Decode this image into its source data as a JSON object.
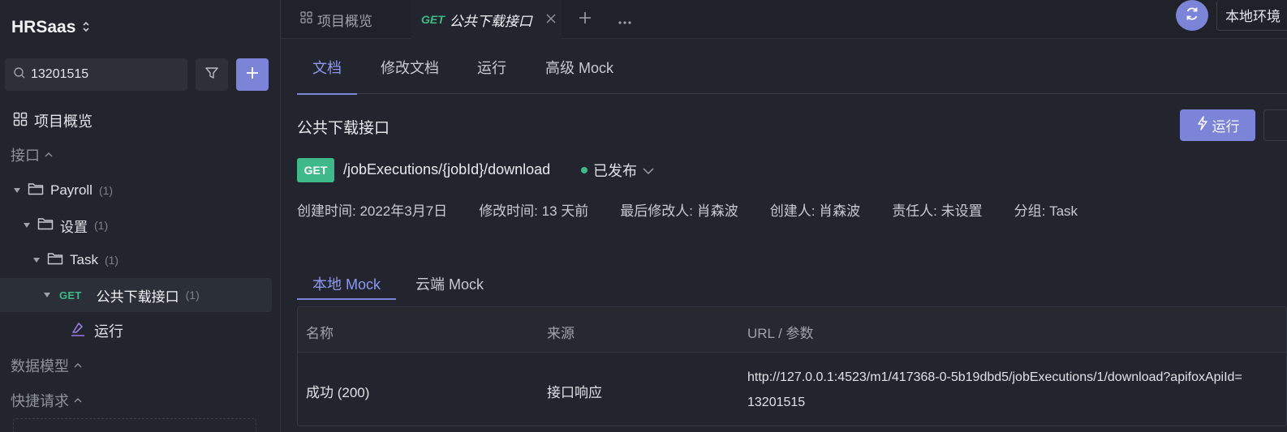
{
  "sidebar": {
    "project_name": "HRSaas",
    "search_value": "13201515",
    "overview_label": "项目概览",
    "sections": {
      "interfaces": "接口",
      "data_models": "数据模型",
      "quick_requests": "快捷请求"
    },
    "tree": [
      {
        "label": "Payroll",
        "count": "(1)"
      },
      {
        "label": "设置",
        "count": "(1)"
      },
      {
        "label": "Task",
        "count": "(1)"
      },
      {
        "method": "GET",
        "label": "公共下载接口",
        "count": "(1)"
      }
    ],
    "run_label": "运行"
  },
  "tabbar": {
    "overview_tab": "项目概览",
    "active_tab_method": "GET",
    "active_tab_title": "公共下载接口",
    "env_label": "本地环境"
  },
  "main": {
    "sub_tabs": [
      "文档",
      "修改文档",
      "运行",
      "高级 Mock"
    ],
    "api_name": "公共下载接口",
    "run_button": "运行",
    "method": "GET",
    "path": "/jobExecutions/{jobId}/download",
    "status": "已发布",
    "meta": [
      "创建时间: 2022年3月7日",
      "修改时间: 13 天前",
      "最后修改人: 肖森波",
      "创建人: 肖森波",
      "责任人: 未设置",
      "分组: Task"
    ],
    "mock_tabs": [
      "本地 Mock",
      "云端 Mock"
    ],
    "mock_table": {
      "headers": [
        "名称",
        "来源",
        "URL / 参数"
      ],
      "rows": [
        {
          "name": "成功 (200)",
          "source": "接口响应",
          "url": "http://127.0.0.1:4523/m1/417368-0-5b19dbd5/jobExecutions/1/download?apifoxApiId=",
          "param": "13201515"
        }
      ]
    }
  },
  "colors": {
    "accent": "#7b84d6",
    "get_green": "#3fb98a",
    "background": "#22252d"
  }
}
